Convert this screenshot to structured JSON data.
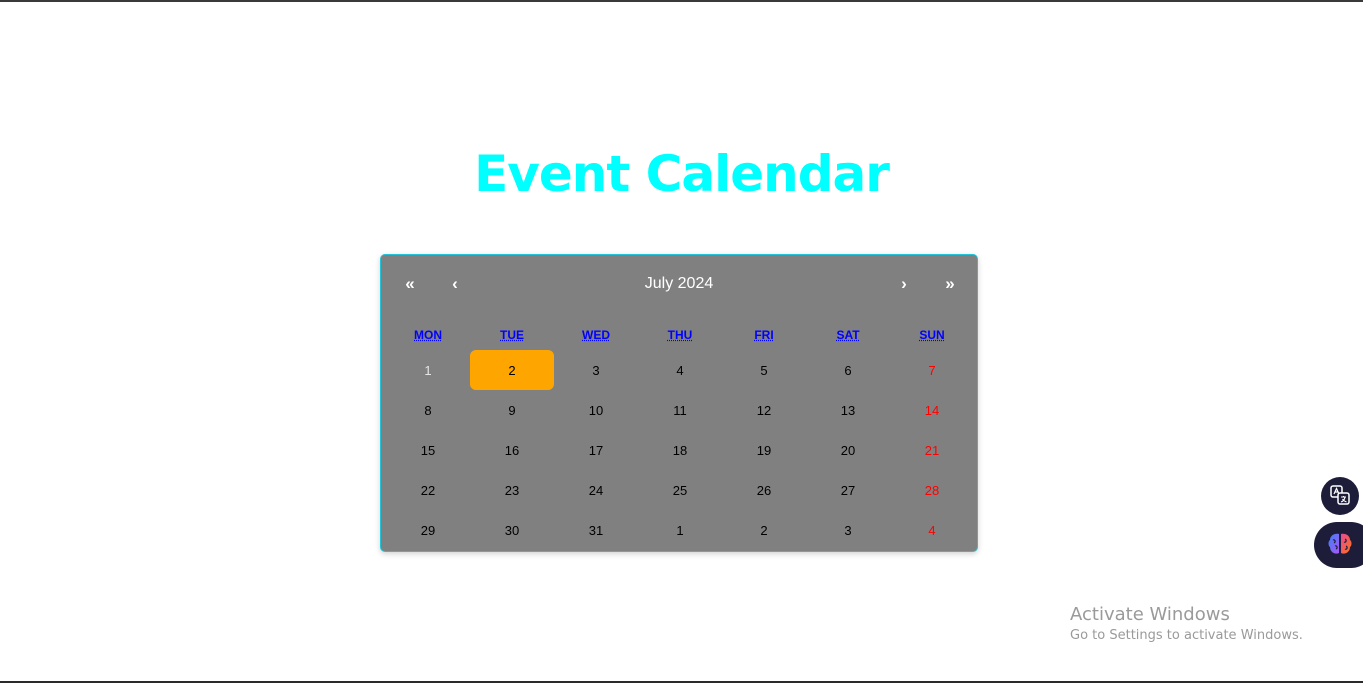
{
  "page": {
    "title": "Event Calendar",
    "title_color": "#00ffff"
  },
  "calendar": {
    "nav": {
      "prev2_label": "«",
      "prev_label": "‹",
      "month_label": "July 2024",
      "next_label": "›",
      "next2_label": "»"
    },
    "weekdays": [
      {
        "abbr": "MON",
        "full": "Monday"
      },
      {
        "abbr": "TUE",
        "full": "Tuesday"
      },
      {
        "abbr": "WED",
        "full": "Wednesday"
      },
      {
        "abbr": "THU",
        "full": "Thursday"
      },
      {
        "abbr": "FRI",
        "full": "Friday"
      },
      {
        "abbr": "SAT",
        "full": "Saturday"
      },
      {
        "abbr": "SUN",
        "full": "Sunday"
      }
    ],
    "weekday_color": "#0000ff",
    "days": [
      {
        "label": "1",
        "state": "past"
      },
      {
        "label": "2",
        "state": "today"
      },
      {
        "label": "3",
        "state": "normal"
      },
      {
        "label": "4",
        "state": "normal"
      },
      {
        "label": "5",
        "state": "normal"
      },
      {
        "label": "6",
        "state": "normal"
      },
      {
        "label": "7",
        "state": "weekend"
      },
      {
        "label": "8",
        "state": "normal"
      },
      {
        "label": "9",
        "state": "normal"
      },
      {
        "label": "10",
        "state": "normal"
      },
      {
        "label": "11",
        "state": "normal"
      },
      {
        "label": "12",
        "state": "normal"
      },
      {
        "label": "13",
        "state": "normal"
      },
      {
        "label": "14",
        "state": "weekend"
      },
      {
        "label": "15",
        "state": "normal"
      },
      {
        "label": "16",
        "state": "normal"
      },
      {
        "label": "17",
        "state": "normal"
      },
      {
        "label": "18",
        "state": "normal"
      },
      {
        "label": "19",
        "state": "normal"
      },
      {
        "label": "20",
        "state": "normal"
      },
      {
        "label": "21",
        "state": "weekend"
      },
      {
        "label": "22",
        "state": "normal"
      },
      {
        "label": "23",
        "state": "normal"
      },
      {
        "label": "24",
        "state": "normal"
      },
      {
        "label": "25",
        "state": "normal"
      },
      {
        "label": "26",
        "state": "normal"
      },
      {
        "label": "27",
        "state": "normal"
      },
      {
        "label": "28",
        "state": "weekend"
      },
      {
        "label": "29",
        "state": "normal"
      },
      {
        "label": "30",
        "state": "normal"
      },
      {
        "label": "31",
        "state": "normal"
      },
      {
        "label": "1",
        "state": "normal"
      },
      {
        "label": "2",
        "state": "normal"
      },
      {
        "label": "3",
        "state": "normal"
      },
      {
        "label": "4",
        "state": "weekend"
      }
    ],
    "colors": {
      "background": "#808080",
      "border": "#22c3d6",
      "today_bg": "#ffa500",
      "weekend_text": "#ff0000",
      "past_text": "#e6e6e6",
      "day_text": "#000000"
    }
  },
  "floating_buttons": {
    "translate_icon": "translate-icon",
    "brain_icon": "brain-icon"
  },
  "watermark": {
    "title": "Activate Windows",
    "subtitle": "Go to Settings to activate Windows."
  }
}
